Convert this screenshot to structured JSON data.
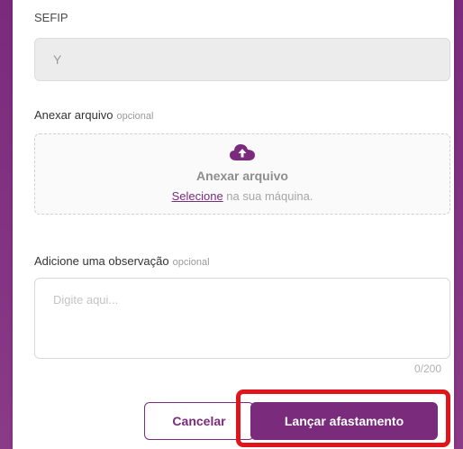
{
  "colors": {
    "brand": "#7a2b7c",
    "highlight": "#e0141b",
    "background": "#ffffff"
  },
  "sefip": {
    "label": "SEFIP",
    "value": "Y"
  },
  "attachment": {
    "label": "Anexar arquivo",
    "optional": "opcional",
    "icon": "cloud-upload-icon",
    "title": "Anexar arquivo",
    "select_link": "Selecione",
    "select_suffix": " na sua máquina."
  },
  "observation": {
    "label": "Adicione uma observação",
    "optional": "opcional",
    "placeholder": "Digite aqui...",
    "counter": "0/200"
  },
  "actions": {
    "cancel_label": "Cancelar",
    "submit_label": "Lançar afastamento"
  }
}
